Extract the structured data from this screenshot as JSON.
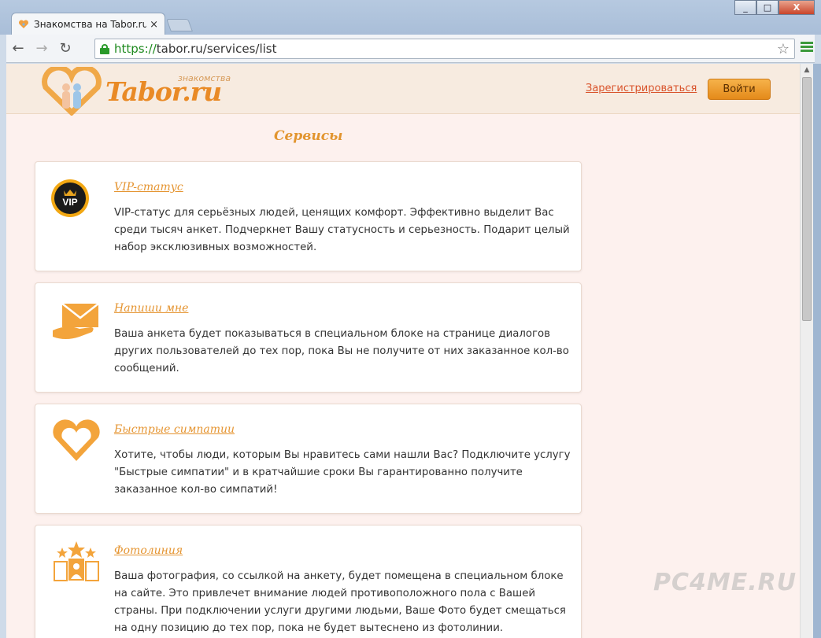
{
  "browser": {
    "tab_title": "Знакомства на Tabor.ru -",
    "tab_close": "×",
    "url_scheme": "https://",
    "url_rest": "tabor.ru/services/list",
    "window_buttons": {
      "minimize": "_",
      "maximize": "□",
      "close": "X"
    },
    "back": "←",
    "forward": "→",
    "reload": "↻",
    "star": "☆"
  },
  "site": {
    "logo_text": "Tabor.ru",
    "logo_sub": "знакомства",
    "register_label": "Зарегистрироваться",
    "login_label": "Войти"
  },
  "page": {
    "title": "Сервисы"
  },
  "services": [
    {
      "name": "VIP-статус",
      "icon": "vip-badge-icon",
      "description": "VIP-статус для серьёзных людей, ценящих комфорт. Эффективно выделит Вас среди тысяч анкет. Подчеркнет Вашу статусность и серьезность. Подарит целый набор эксклюзивных возможностей."
    },
    {
      "name": "Напиши мне",
      "icon": "envelope-hand-icon",
      "description": "Ваша анкета будет показываться в специальном блоке на странице диалогов других пользователей до тех пор, пока Вы не получите от них заказанное кол-во сообщений."
    },
    {
      "name": "Быстрые симпатии",
      "icon": "heart-icon",
      "description": "Хотите, чтобы люди, которым Вы нравитесь сами нашли Вас? Подключите услугу \"Быстрые симпатии\" и в кратчайшие сроки Вы гарантированно получите заказанное кол-во симпатий!"
    },
    {
      "name": "Фотолиния",
      "icon": "photo-stars-icon",
      "description": "Ваша фотография, со ссылкой на анкету, будет помещена в специальном блоке на сайте. Это привлечет внимание людей противоположного пола с Вашей страны. При подключении услуги другими людьми, Ваше Фото будет смещаться на одну позицию до тех пор, пока не будет вытеснено из фотолинии."
    }
  ],
  "watermark": "PC4ME.RU",
  "colors": {
    "accent": "#e59532",
    "page_bg": "#fdf1ee",
    "button": "#f0a030"
  }
}
